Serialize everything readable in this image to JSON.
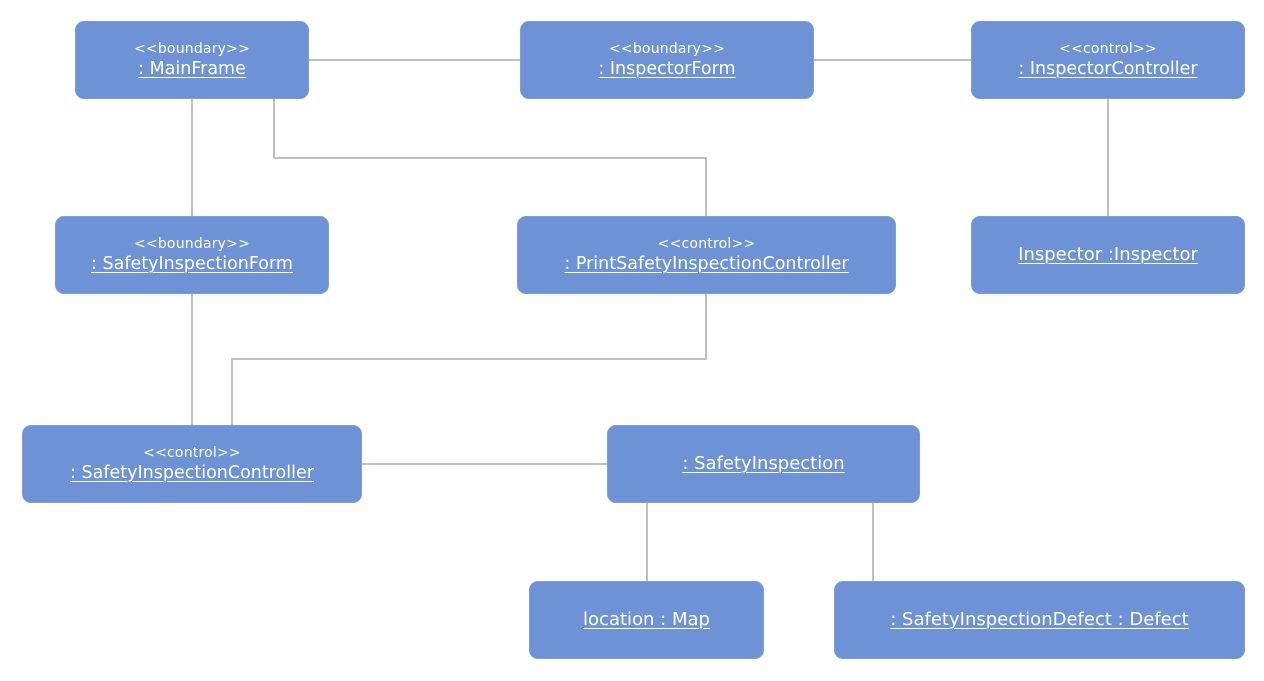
{
  "diagram": {
    "type": "UML communication/object diagram",
    "colors": {
      "node_fill": "#6d93d6",
      "node_text": "#ffffff",
      "connector": "#c0c0c0",
      "background": "#ffffff"
    },
    "nodes": {
      "mainframe": {
        "stereotype": "<<boundary>>",
        "name": ": MainFrame"
      },
      "inspectorform": {
        "stereotype": "<<boundary>>",
        "name": ": InspectorForm"
      },
      "inspectorcontroller": {
        "stereotype": "<<control>>",
        "name": ": InspectorController"
      },
      "safetyform": {
        "stereotype": "<<boundary>>",
        "name": ": SafetyInspectionForm"
      },
      "printcontroller": {
        "stereotype": "<<control>>",
        "name": ": PrintSafetyInspectionController"
      },
      "inspector": {
        "stereotype": "",
        "name": "Inspector :Inspector"
      },
      "safetycontroller": {
        "stereotype": "<<control>>",
        "name": ": SafetyInspectionController"
      },
      "safetyinspection": {
        "stereotype": "",
        "name": ": SafetyInspection"
      },
      "location": {
        "stereotype": "",
        "name": "location : Map"
      },
      "defect": {
        "stereotype": "",
        "name": ": SafetyInspectionDefect : Defect"
      }
    },
    "links": [
      {
        "from": "mainframe",
        "to": "inspectorform"
      },
      {
        "from": "inspectorform",
        "to": "inspectorcontroller"
      },
      {
        "from": "inspectorcontroller",
        "to": "inspector"
      },
      {
        "from": "mainframe",
        "to": "safetyform"
      },
      {
        "from": "mainframe",
        "to": "printcontroller"
      },
      {
        "from": "safetyform",
        "to": "safetycontroller"
      },
      {
        "from": "printcontroller",
        "to": "safetycontroller"
      },
      {
        "from": "safetycontroller",
        "to": "safetyinspection"
      },
      {
        "from": "safetyinspection",
        "to": "location"
      },
      {
        "from": "safetyinspection",
        "to": "defect"
      }
    ]
  }
}
